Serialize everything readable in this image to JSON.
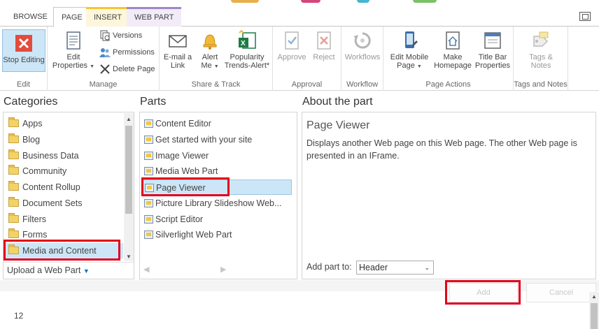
{
  "tabs": {
    "browse": "BROWSE",
    "page": "PAGE",
    "insert": "INSERT",
    "web_part": "WEB PART"
  },
  "ribbon": {
    "edit": {
      "stop_editing": "Stop Editing",
      "label": "Edit"
    },
    "manage": {
      "edit_properties": "Edit Properties",
      "versions": "Versions",
      "permissions": "Permissions",
      "delete_page": "Delete Page",
      "label": "Manage"
    },
    "share_track": {
      "email_link": "E-mail a Link",
      "alert_me": "Alert Me",
      "popularity": "Popularity Trends-Alert*",
      "label": "Share & Track"
    },
    "approval": {
      "approve": "Approve",
      "reject": "Reject",
      "label": "Approval"
    },
    "workflow": {
      "workflows": "Workflows",
      "label": "Workflow"
    },
    "page_actions": {
      "edit_mobile": "Edit Mobile Page",
      "make_homepage": "Make Homepage",
      "title_bar": "Title Bar Properties",
      "label": "Page Actions"
    },
    "tags_notes": {
      "tags_notes": "Tags & Notes",
      "label": "Tags and Notes"
    }
  },
  "categories": {
    "heading": "Categories",
    "items": [
      "Apps",
      "Blog",
      "Business Data",
      "Community",
      "Content Rollup",
      "Document Sets",
      "Filters",
      "Forms",
      "Media and Content"
    ],
    "upload": "Upload a Web Part"
  },
  "parts": {
    "heading": "Parts",
    "items": [
      "Content Editor",
      "Get started with your site",
      "Image Viewer",
      "Media Web Part",
      "Page Viewer",
      "Picture Library Slideshow Web...",
      "Script Editor",
      "Silverlight Web Part"
    ]
  },
  "about": {
    "heading": "About the part",
    "title": "Page Viewer",
    "description": "Displays another Web page on this Web page. The other Web page is presented in an IFrame.",
    "add_part_to_label": "Add part to:",
    "add_part_to_value": "Header"
  },
  "buttons": {
    "add": "Add",
    "cancel": "Cancel"
  },
  "footer": {
    "number": "12"
  },
  "colors": {
    "highlight_red": "#e2001a",
    "selected_bg": "#cde6f7",
    "accent_blue": "#0072c6"
  }
}
